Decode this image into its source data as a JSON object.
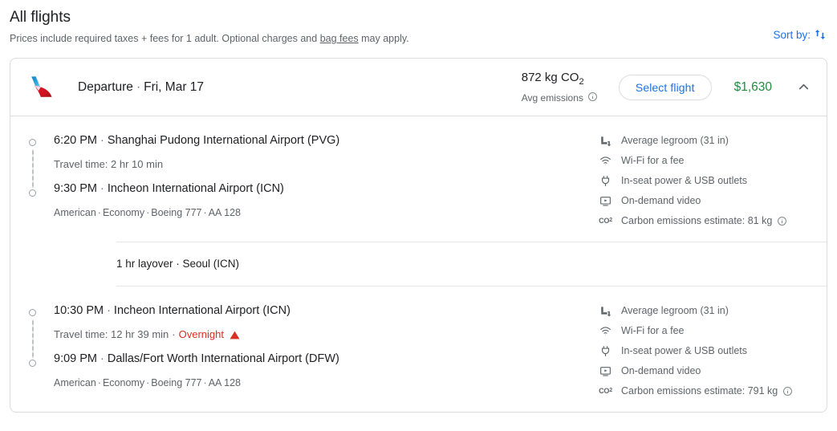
{
  "header": {
    "title": "All flights",
    "subtitle_before": "Prices include required taxes + fees for 1 adult. Optional charges and ",
    "subtitle_link": "bag fees",
    "subtitle_after": " may apply.",
    "sort_label": "Sort by:",
    "sort_icon": "sort-arrows-icon"
  },
  "colors": {
    "accent_blue": "#1a73e8",
    "price_green": "#1e8e3e",
    "warning_red": "#d93025",
    "text_primary": "#202124",
    "text_secondary": "#5f6368",
    "border": "#dadce0"
  },
  "flight": {
    "airline_logo": "american-airlines-logo",
    "direction_label": "Departure",
    "separator": "·",
    "date": "Fri, Mar 17",
    "emissions_value": "872 kg CO",
    "emissions_subscript": "2",
    "emissions_label": "Avg emissions",
    "emissions_info_icon": "info-icon",
    "select_button": "Select flight",
    "price": "$1,630",
    "collapse_icon": "chevron-up-icon",
    "segments": [
      {
        "depart_time": "6:20 PM",
        "depart_airport": "Shanghai Pudong International Airport (PVG)",
        "travel_time": "Travel time: 2 hr 10 min",
        "overnight": "",
        "arrive_time": "9:30 PM",
        "arrive_airport": "Incheon International Airport (ICN)",
        "meta_airline": "American",
        "meta_cabin": "Economy",
        "meta_aircraft": "Boeing 777",
        "meta_flight_number": "AA 128",
        "amenities": [
          {
            "icon": "legroom-icon",
            "label": "Average legroom (31 in)"
          },
          {
            "icon": "wifi-icon",
            "label": "Wi-Fi for a fee"
          },
          {
            "icon": "power-plug-icon",
            "label": "In-seat power & USB outlets"
          },
          {
            "icon": "on-demand-video-icon",
            "label": "On-demand video"
          },
          {
            "icon": "co2-icon",
            "label": "Carbon emissions estimate: 81 kg",
            "info": "info-icon"
          }
        ]
      },
      {
        "depart_time": "10:30 PM",
        "depart_airport": "Incheon International Airport (ICN)",
        "travel_time": "Travel time: 12 hr 39 min",
        "overnight": "Overnight",
        "arrive_time": "9:09 PM",
        "arrive_airport": "Dallas/Fort Worth International Airport (DFW)",
        "meta_airline": "American",
        "meta_cabin": "Economy",
        "meta_aircraft": "Boeing 777",
        "meta_flight_number": "AA 128",
        "amenities": [
          {
            "icon": "legroom-icon",
            "label": "Average legroom (31 in)"
          },
          {
            "icon": "wifi-icon",
            "label": "Wi-Fi for a fee"
          },
          {
            "icon": "power-plug-icon",
            "label": "In-seat power & USB outlets"
          },
          {
            "icon": "on-demand-video-icon",
            "label": "On-demand video"
          },
          {
            "icon": "co2-icon",
            "label": "Carbon emissions estimate: 791 kg",
            "info": "info-icon"
          }
        ]
      }
    ],
    "layover": "1 hr layover · Seoul (ICN)"
  }
}
